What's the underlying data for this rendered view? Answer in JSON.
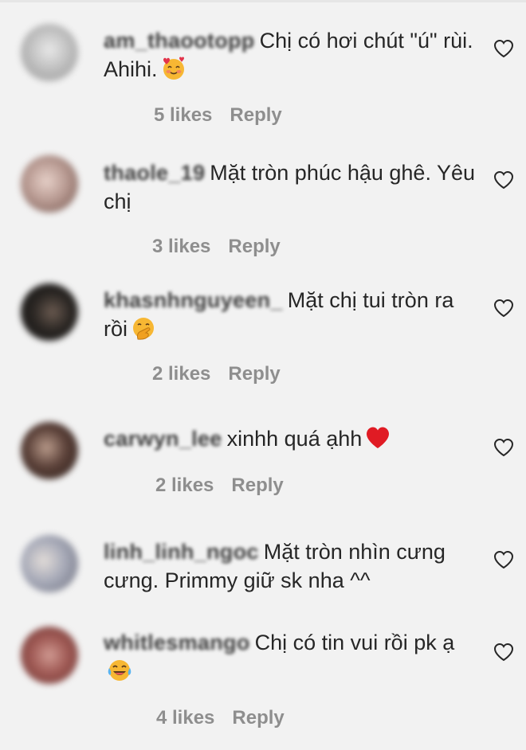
{
  "comments": [
    {
      "username": "am_thaootopp",
      "text": "Chị có hơi chút \"ú\" rùi. Ahihi.",
      "emoji": "smiling-face-with-hearts",
      "likes": "5 likes",
      "reply": "Reply",
      "avatar_color": "#b8b8b8"
    },
    {
      "username": "thaole_19",
      "text": "Mặt tròn phúc hậu ghê. Yêu chị",
      "emoji": "",
      "likes": "3 likes",
      "reply": "Reply",
      "avatar_color": "#b89a92"
    },
    {
      "username": "khasnhnguyeen_",
      "text": "Mặt chị tui tròn ra rồi",
      "emoji": "face-with-hand-over-mouth",
      "likes": "2 likes",
      "reply": "Reply",
      "avatar_color": "#2a2623"
    },
    {
      "username": "carwyn_lee",
      "text": "xinhh quá ạhh",
      "emoji": "red-heart",
      "likes": "2 likes",
      "reply": "Reply",
      "avatar_color": "#5a4038"
    },
    {
      "username": "linh_linh_ngoc",
      "text": "Mặt tròn nhìn cưng cưng. Primmy giữ sk nha ^^",
      "emoji": "",
      "likes": "",
      "reply": "",
      "avatar_color": "#a7aab8"
    },
    {
      "username": "whitlesmango",
      "text": "Chị có tin vui rồi pk ạ",
      "emoji": "face-with-tears-of-joy",
      "likes": "4 likes",
      "reply": "Reply",
      "avatar_color": "#a05a55"
    }
  ],
  "colors": {
    "background": "#f2f2f2",
    "text": "#262626",
    "meta": "#8e8e8e"
  },
  "icons": {
    "like": "heart-outline-icon"
  }
}
